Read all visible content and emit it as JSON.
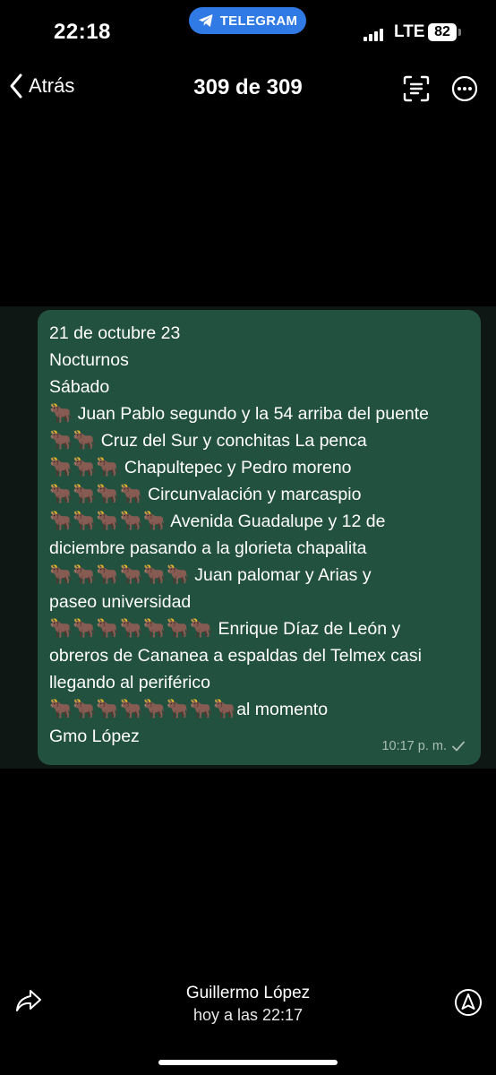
{
  "status_bar": {
    "time": "22:18",
    "app_pill": "TELEGRAM",
    "network": "LTE",
    "battery": "82"
  },
  "nav": {
    "back_label": "Atrás",
    "counter": "309 de 309"
  },
  "message": {
    "lines": [
      {
        "text": "21 de octubre 23"
      },
      {
        "text": "Nocturnos"
      },
      {
        "text": "Sábado"
      },
      {
        "bulls": "🐂",
        "text": " Juan Pablo segundo y la 54 arriba del puente"
      },
      {
        "bulls": "🐂🐂",
        "text": " Cruz del Sur y conchitas La penca"
      },
      {
        "bulls": "🐂🐂🐂",
        "text": " Chapultepec y Pedro moreno"
      },
      {
        "bulls": "🐂🐂🐂🐂",
        "text": " Circunvalación y marcaspio"
      },
      {
        "bulls": "🐂🐂🐂🐂🐂",
        "text": " Avenida Guadalupe y 12 de",
        "cont": [
          "diciembre pasando a la glorieta chapalita"
        ]
      },
      {
        "bulls": "🐂🐂🐂🐂🐂🐂",
        "text": " Juan palomar y Arias y",
        "cont": [
          "paseo universidad"
        ]
      },
      {
        "bulls": "🐂🐂🐂🐂🐂🐂🐂",
        "text": " Enrique Díaz de León y",
        "cont": [
          "obreros de Cananea a espaldas del Telmex casi",
          "llegando al periférico"
        ]
      },
      {
        "bulls": "🐂🐂🐂🐂🐂🐂🐂🐂",
        "text": "al momento"
      },
      {
        "text": "Gmo López"
      }
    ],
    "time": "10:17 p. m.",
    "status_icon": "check-icon"
  },
  "footer": {
    "author": "Guillermo López",
    "time": "hoy a las 22:17"
  },
  "colors": {
    "pill": "#2f7ae5",
    "bubble": "#235140",
    "chat_bg": "#0e1714"
  }
}
